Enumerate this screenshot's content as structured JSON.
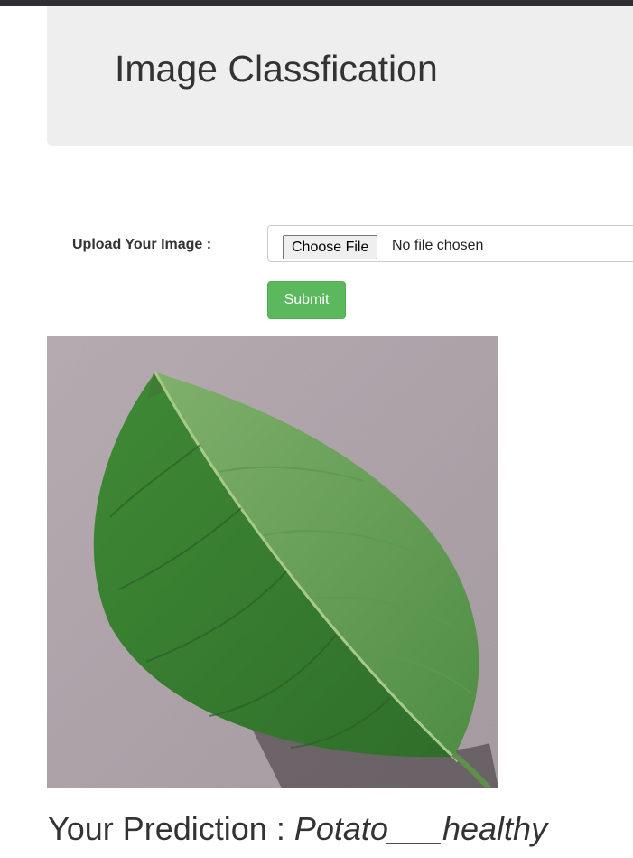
{
  "header": {
    "title": "Image Classfication"
  },
  "form": {
    "upload_label": "Upload Your Image :",
    "choose_file_label": "Choose File",
    "no_file_text": "No file chosen",
    "submit_label": "Submit"
  },
  "result": {
    "prediction_label": "Your Prediction : ",
    "prediction_value": "Potato___healthy"
  },
  "colors": {
    "submit_green": "#5cb85c",
    "jumbotron_bg": "#eeeeee",
    "leaf_green": "#4f8f3c",
    "background_mauve": "#a89ca3"
  }
}
